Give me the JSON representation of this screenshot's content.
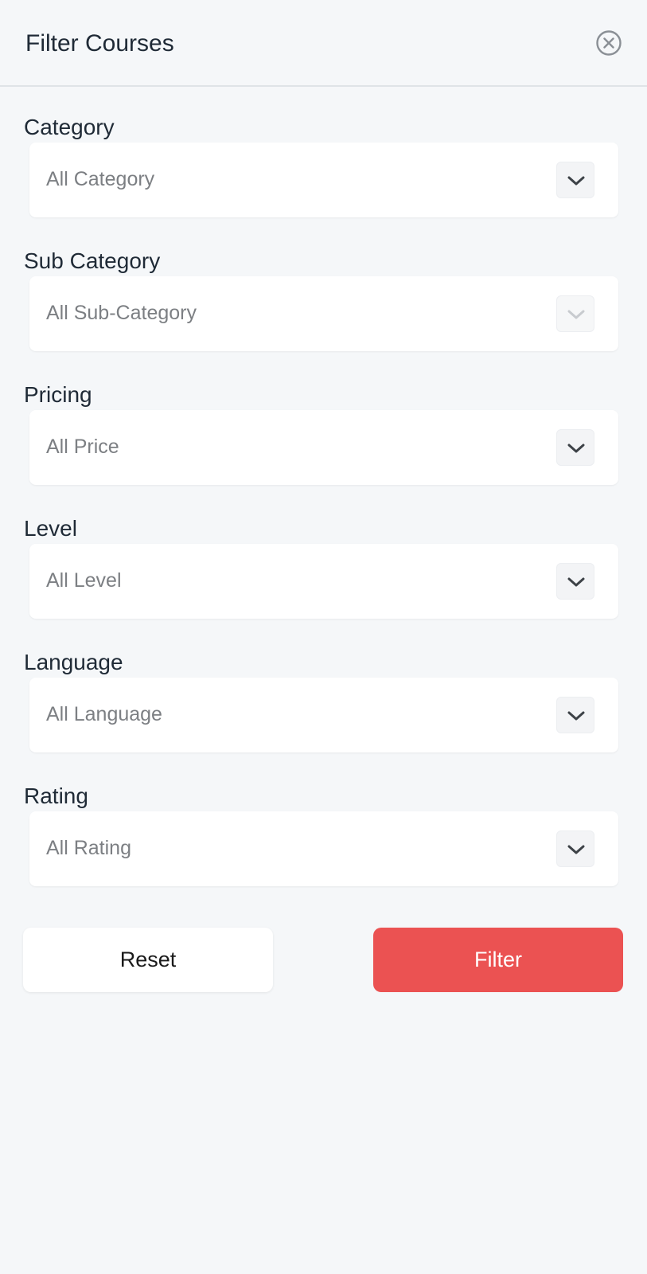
{
  "header": {
    "title": "Filter Courses"
  },
  "filters": [
    {
      "label": "Category",
      "value": "All Category",
      "enabled": true
    },
    {
      "label": "Sub Category",
      "value": "All Sub-Category",
      "enabled": false
    },
    {
      "label": "Pricing",
      "value": "All Price",
      "enabled": true
    },
    {
      "label": "Level",
      "value": "All Level",
      "enabled": true
    },
    {
      "label": "Language",
      "value": "All Language",
      "enabled": true
    },
    {
      "label": "Rating",
      "value": "All Rating",
      "enabled": true
    }
  ],
  "actions": {
    "reset_label": "Reset",
    "filter_label": "Filter"
  },
  "colors": {
    "accent": "#eb5252",
    "background": "#f5f7f9",
    "text": "#1f2a36",
    "muted": "#7c7f83"
  },
  "icons": {
    "close": "close-circle-icon",
    "dropdown": "chevron-down-icon"
  }
}
